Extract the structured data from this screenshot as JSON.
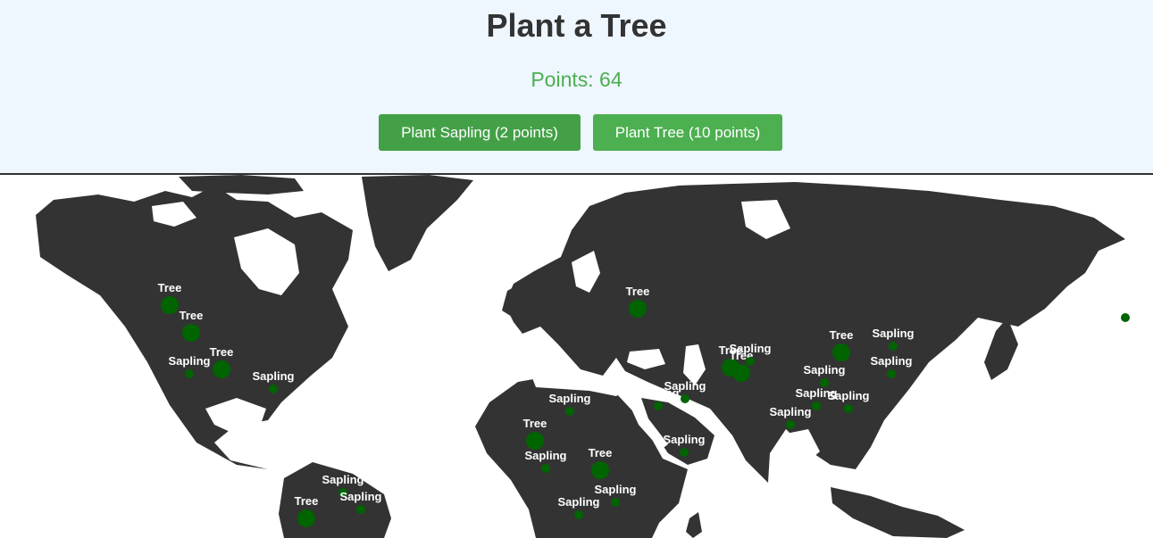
{
  "title": "Plant a Tree",
  "points_text": "Points: 64",
  "buttons": {
    "sapling_label": "Plant Sapling (2 points)",
    "tree_label": "Plant Tree (10 points)"
  },
  "colors": {
    "land": "#333333",
    "water": "#ffffff",
    "header_bg": "#eef6fe",
    "accent": "#4caf50",
    "marker": "#006400"
  },
  "markers": [
    {
      "type": "tree",
      "label": "Tree"
    },
    {
      "type": "tree",
      "label": "Tree"
    },
    {
      "type": "tree",
      "label": "Tree"
    },
    {
      "type": "sapling",
      "label": "Sapling"
    },
    {
      "type": "sapling",
      "label": "Sapling"
    },
    {
      "type": "sapling",
      "label": "Sapling"
    },
    {
      "type": "sapling",
      "label": "Sapling"
    },
    {
      "type": "tree",
      "label": "Tree"
    },
    {
      "type": "tree",
      "label": "Tree"
    },
    {
      "type": "sapling",
      "label": "Sapling"
    },
    {
      "type": "tree",
      "label": "Tree"
    },
    {
      "type": "sapling",
      "label": "Sapling"
    },
    {
      "type": "tree",
      "label": "Tree"
    },
    {
      "type": "sapling",
      "label": "Sapling"
    },
    {
      "type": "sapling",
      "label": "Sapling"
    },
    {
      "type": "sapling",
      "label": "Sapling"
    },
    {
      "type": "sapling",
      "label": "Sapling"
    },
    {
      "type": "sapling",
      "label": "Sapling"
    },
    {
      "type": "tree",
      "label": "Tree"
    },
    {
      "type": "sapling",
      "label": "Sapling"
    },
    {
      "type": "tree",
      "label": "Tree"
    },
    {
      "type": "tree",
      "label": "Tree"
    },
    {
      "type": "sapling",
      "label": "Sapling"
    },
    {
      "type": "sapling",
      "label": "Sapling"
    },
    {
      "type": "sapling",
      "label": "Sapling"
    },
    {
      "type": "sapling",
      "label": "Sapling"
    },
    {
      "type": "sapling",
      "label": "Sapling"
    },
    {
      "type": "sapling",
      "label": "Sapling"
    },
    {
      "type": "sapling",
      "label": "Sapling"
    }
  ]
}
